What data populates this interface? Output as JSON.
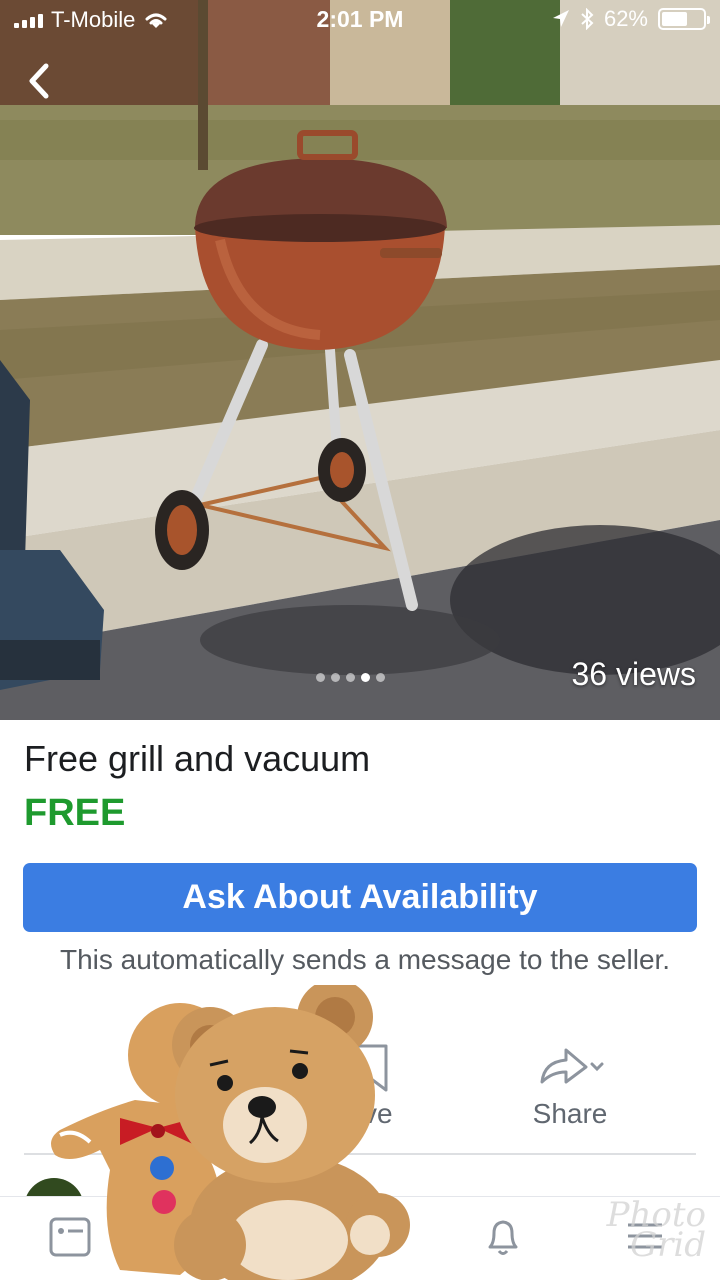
{
  "status_bar": {
    "carrier": "T-Mobile",
    "time": "2:01 PM",
    "battery": "62%",
    "battery_level": 0.62
  },
  "photo": {
    "views": "36 views",
    "carousel_count": 5,
    "carousel_active_index": 3
  },
  "listing": {
    "title": "Free grill and vacuum",
    "price": "FREE",
    "price_color": "#1e9a2e"
  },
  "ask": {
    "button_label": "Ask About Availability",
    "note": "This automatically sends a message to the seller.",
    "button_color": "#3b7de2"
  },
  "actions": {
    "save_label": "ave",
    "share_label": "Share"
  },
  "bottom_nav": {
    "items": [
      "marketplace-icon",
      "bell-icon",
      "menu-icon"
    ]
  },
  "watermark": {
    "line1": "Photo",
    "line2": "Grid"
  }
}
